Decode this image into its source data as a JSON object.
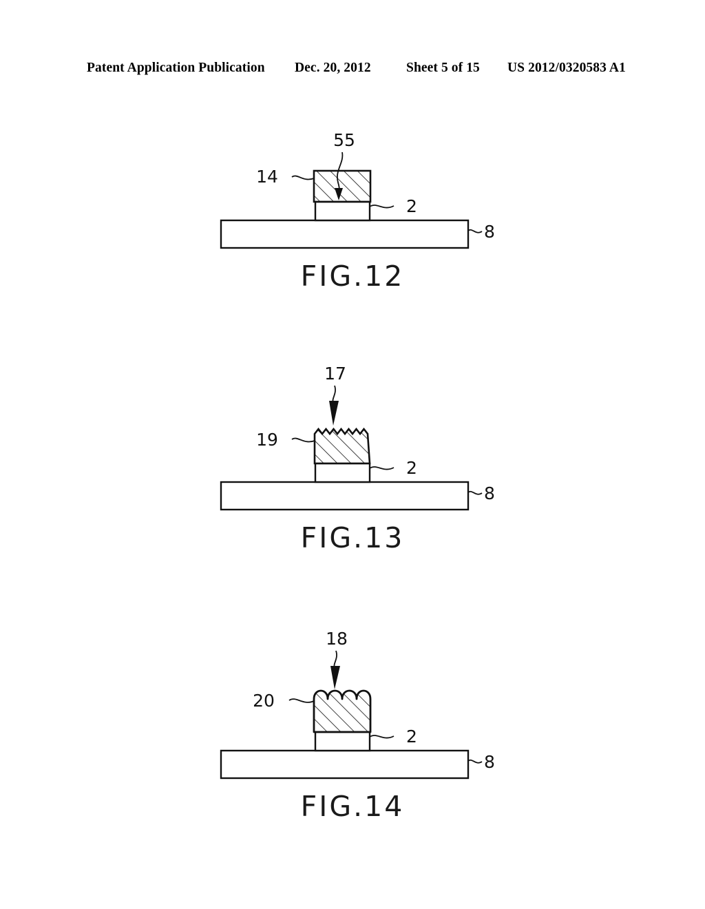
{
  "header": {
    "left": "Patent Application Publication",
    "date": "Dec. 20, 2012",
    "sheet": "Sheet 5 of 15",
    "publication_number": "US 2012/0320583 A1"
  },
  "figures": [
    {
      "id": "fig-12",
      "caption": "FIG.12",
      "description": "Cross-section: hatched layer on a plain layer on a substrate, with an arrow indicating a region inside the hatched layer.",
      "labels": [
        {
          "name": "label-14",
          "text": "14",
          "target": "hatched-layer",
          "leader": "wavy"
        },
        {
          "name": "label-55",
          "text": "55",
          "target": "hatched-layer-interior",
          "leader": "curved-arrow"
        },
        {
          "name": "label-2",
          "text": "2",
          "target": "middle-layer",
          "leader": "wavy"
        },
        {
          "name": "label-8",
          "text": "8",
          "target": "substrate",
          "leader": "wavy"
        }
      ],
      "top_surface": "flat"
    },
    {
      "id": "fig-13",
      "caption": "FIG.13",
      "description": "Cross-section: hatched layer with a sawtooth (jagged) top surface on a plain layer on a substrate; a downward arrow points at the textured surface.",
      "labels": [
        {
          "name": "label-17",
          "text": "17",
          "target": "sawtooth-surface",
          "leader": "curved-arrow"
        },
        {
          "name": "label-19",
          "text": "19",
          "target": "hatched-layer",
          "leader": "wavy"
        },
        {
          "name": "label-2",
          "text": "2",
          "target": "middle-layer",
          "leader": "wavy"
        },
        {
          "name": "label-8",
          "text": "8",
          "target": "substrate",
          "leader": "wavy"
        }
      ],
      "top_surface": "sawtooth"
    },
    {
      "id": "fig-14",
      "caption": "FIG.14",
      "description": "Cross-section: hatched layer with a scalloped (rounded bump) top surface on a plain layer on a substrate; a downward arrow points at the textured surface.",
      "labels": [
        {
          "name": "label-18",
          "text": "18",
          "target": "scalloped-surface",
          "leader": "curved-arrow"
        },
        {
          "name": "label-20",
          "text": "20",
          "target": "hatched-layer",
          "leader": "wavy"
        },
        {
          "name": "label-2",
          "text": "2",
          "target": "middle-layer",
          "leader": "wavy"
        },
        {
          "name": "label-8",
          "text": "8",
          "target": "substrate",
          "leader": "wavy"
        }
      ],
      "top_surface": "scalloped"
    }
  ],
  "colors": {
    "ink": "#111111",
    "paper": "#ffffff"
  }
}
